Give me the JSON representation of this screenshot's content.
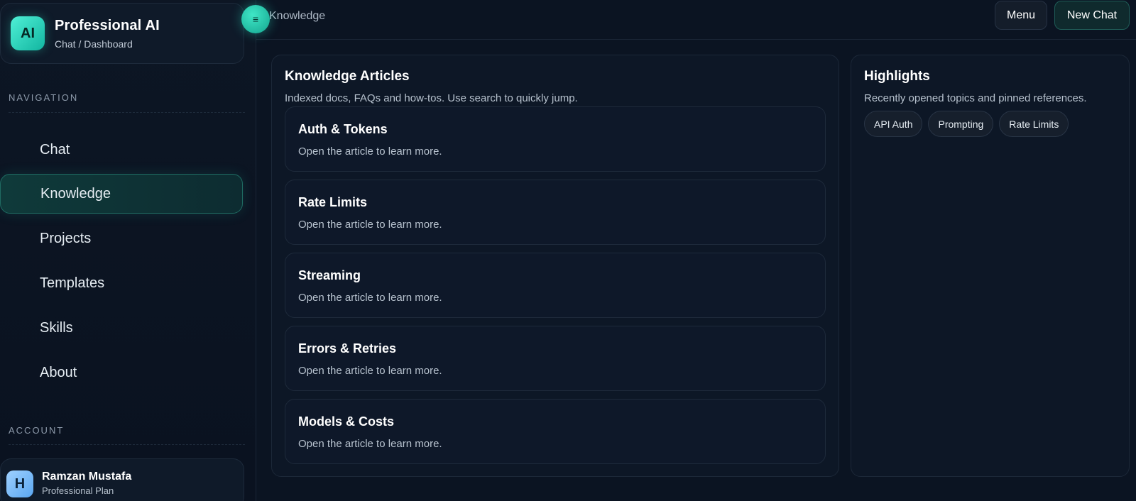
{
  "brand": {
    "badge": "AI",
    "title": "Professional AI",
    "subtitle": "Chat / Dashboard"
  },
  "sidebar": {
    "navigation_label": "NAVIGATION",
    "items": [
      {
        "label": "Chat",
        "active": false
      },
      {
        "label": "Knowledge",
        "active": true
      },
      {
        "label": "Projects",
        "active": false
      },
      {
        "label": "Templates",
        "active": false
      },
      {
        "label": "Skills",
        "active": false
      },
      {
        "label": "About",
        "active": false
      }
    ],
    "account_label": "ACCOUNT"
  },
  "user": {
    "initial": "H",
    "name": "Ramzan Mustafa",
    "plan": "Professional Plan"
  },
  "toggle": {
    "glyph": "≡",
    "icon": "menu-toggle-icon"
  },
  "topbar": {
    "breadcrumb": "Knowledge",
    "menu_label": "Menu",
    "new_chat_label": "New Chat"
  },
  "articles_panel": {
    "title": "Knowledge Articles",
    "description": "Indexed docs, FAQs and how-tos. Use search to quickly jump.",
    "articles": [
      {
        "title": "Auth & Tokens",
        "subtitle": "Open the article to learn more."
      },
      {
        "title": "Rate Limits",
        "subtitle": "Open the article to learn more."
      },
      {
        "title": "Streaming",
        "subtitle": "Open the article to learn more."
      },
      {
        "title": "Errors & Retries",
        "subtitle": "Open the article to learn more."
      },
      {
        "title": "Models & Costs",
        "subtitle": "Open the article to learn more."
      }
    ]
  },
  "highlights_panel": {
    "title": "Highlights",
    "description": "Recently opened topics and pinned references.",
    "chips": [
      "API Auth",
      "Prompting",
      "Rate Limits"
    ]
  },
  "colors": {
    "accent": "#2ed3b7",
    "background": "#0b1320",
    "panel": "#0d1726"
  }
}
